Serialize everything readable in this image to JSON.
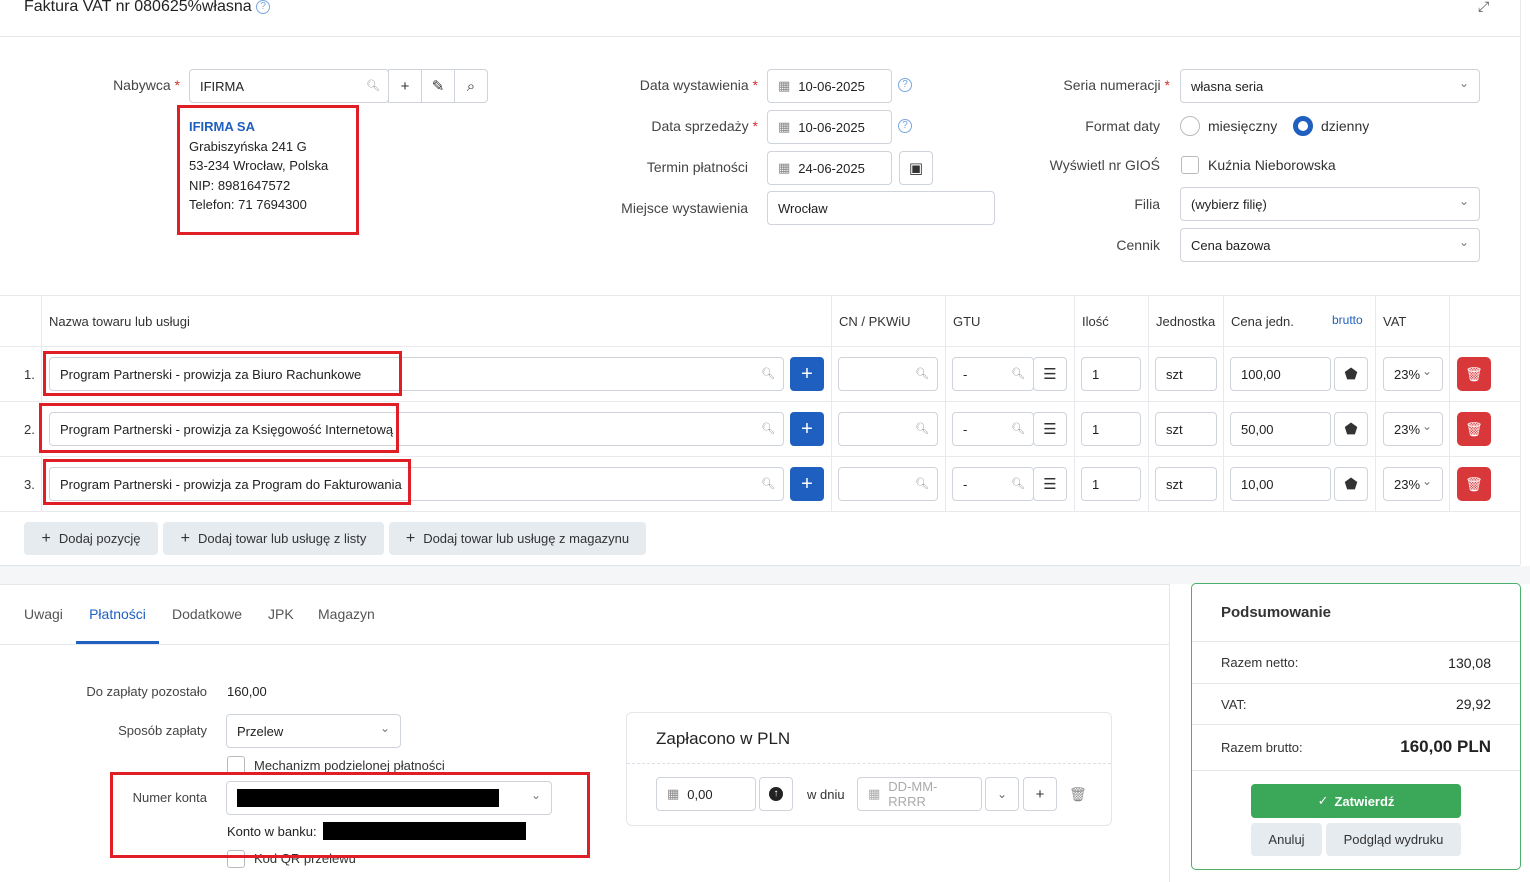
{
  "header": {
    "title": "Faktura VAT nr 080625%własna",
    "help_icon": "?"
  },
  "buyer": {
    "label": "Nabywca",
    "value": "IFIRMA",
    "name": "IFIRMA SA",
    "street": "Grabiszyńska 241 G",
    "city": "53-234 Wrocław, Polska",
    "nip": "NIP: 8981647572",
    "phone": "Telefon: 71 7694300"
  },
  "dates": {
    "issue_label": "Data wystawienia",
    "issue_value": "10-06-2025",
    "sale_label": "Data sprzedaży",
    "sale_value": "10-06-2025",
    "due_label": "Termin płatności",
    "due_value": "24-06-2025",
    "place_label": "Miejsce wystawienia",
    "place_value": "Wrocław"
  },
  "right": {
    "series_label": "Seria numeracji",
    "series_value": "własna seria",
    "date_format_label": "Format daty",
    "monthly": "miesięczny",
    "daily": "dzienny",
    "gios_label": "Wyświetl nr GIOŚ",
    "gios_value": "Kuźnia Nieborowska",
    "branch_label": "Filia",
    "branch_value": "(wybierz filię)",
    "pricelist_label": "Cennik",
    "pricelist_value": "Cena bazowa"
  },
  "table": {
    "headers": {
      "name": "Nazwa towaru lub usługi",
      "cn": "CN / PKWiU",
      "gtu": "GTU",
      "qty": "Ilość",
      "unit": "Jednostka",
      "price": "Cena jedn.",
      "gross": "brutto",
      "vat": "VAT"
    },
    "rows": [
      {
        "num": "1.",
        "name": "Program Partnerski - prowizja za Biuro Rachunkowe",
        "gtu": "-",
        "qty": "1",
        "unit": "szt",
        "price": "100,00",
        "vat": "23%"
      },
      {
        "num": "2.",
        "name": "Program Partnerski - prowizja za Księgowość Internetową",
        "gtu": "-",
        "qty": "1",
        "unit": "szt",
        "price": "50,00",
        "vat": "23%"
      },
      {
        "num": "3.",
        "name": "Program Partnerski - prowizja za Program do Fakturowania",
        "gtu": "-",
        "qty": "1",
        "unit": "szt",
        "price": "10,00",
        "vat": "23%"
      }
    ],
    "add_position": "Dodaj pozycję",
    "add_from_list": "Dodaj towar lub usługę z listy",
    "add_from_warehouse": "Dodaj towar lub usługę z magazynu"
  },
  "tabs": [
    "Uwagi",
    "Płatności",
    "Dodatkowe",
    "JPK",
    "Magazyn"
  ],
  "payment": {
    "remaining_label": "Do zapłaty pozostało",
    "remaining_value": "160,00",
    "method_label": "Sposób zapłaty",
    "method_value": "Przelew",
    "split_label": "Mechanizm podzielonej płatności",
    "account_label": "Numer konta",
    "bank_label": "Konto w banku:",
    "qr_label": "Kod QR przelewu",
    "paid_title": "Zapłacono w PLN",
    "paid_value": "0,00",
    "on_day": "w dniu",
    "date_placeholder": "DD-MM-RRRR"
  },
  "summary": {
    "title": "Podsumowanie",
    "net_label": "Razem netto:",
    "net_value": "130,08",
    "vat_label": "VAT:",
    "vat_value": "29,92",
    "gross_label": "Razem brutto:",
    "gross_value": "160,00 PLN",
    "confirm": "Zatwierdź",
    "cancel": "Anuluj",
    "preview": "Podgląd wydruku"
  }
}
